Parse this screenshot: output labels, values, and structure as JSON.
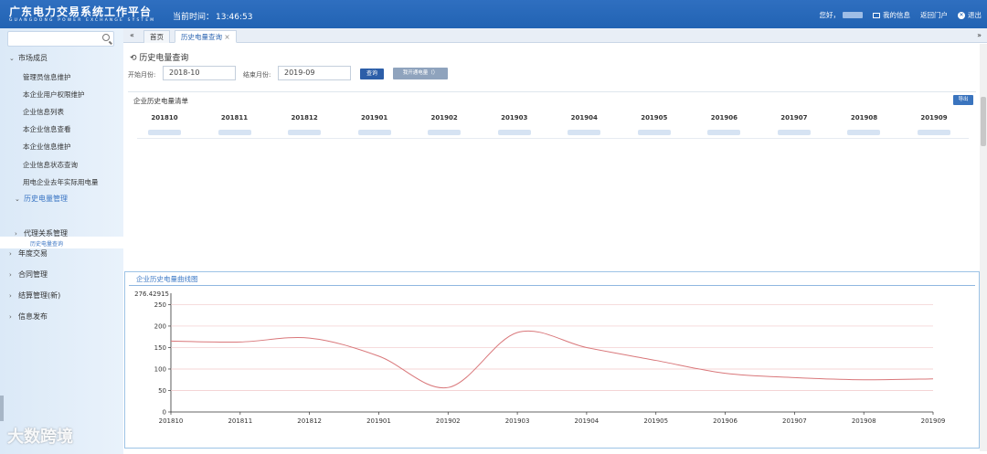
{
  "header": {
    "title": "广东电力交易系统工作平台",
    "subtitle": "GUANGDONG POWER EXCHANGE SYSTEM",
    "clock_label": "当前时间：",
    "clock_value": "13:46:53",
    "greeting": "您好，",
    "my_info": "我的信息",
    "portal": "返回门户",
    "logout": "退出"
  },
  "sidebar": {
    "groups": [
      {
        "label": "市场成员",
        "expanded": true
      },
      {
        "label": "年度交易"
      },
      {
        "label": "合同管理"
      },
      {
        "label": "结算管理(新)"
      },
      {
        "label": "信息发布"
      }
    ],
    "items": [
      "管理员信息维护",
      "本企业用户权限维护",
      "企业信息列表",
      "本企业信息查看",
      "本企业信息维护",
      "企业信息状态查询",
      "用电企业去年实际用电量"
    ],
    "history_group": "历史电量管理",
    "history_item": "历史电量查询",
    "agent_group": "代理关系管理"
  },
  "tabs": {
    "home": "首页",
    "current": "历史电量查询",
    "close": "×"
  },
  "page": {
    "title": "历史电量查询",
    "start_label": "开始月份:",
    "start_value": "2018-10",
    "end_label": "结束月份:",
    "end_value": "2019-09",
    "query_btn": "查询",
    "open_btn": "我开通电量（）",
    "list_title": "企业历史电量清单",
    "export_btn": "导出",
    "chart_title": "企业历史电量曲线图"
  },
  "table_columns": [
    "201810",
    "201811",
    "201812",
    "201901",
    "201902",
    "201903",
    "201904",
    "201905",
    "201906",
    "201907",
    "201908",
    "201909"
  ],
  "chart_data": {
    "type": "line",
    "categories": [
      "201810",
      "201811",
      "201812",
      "201901",
      "201902",
      "201903",
      "201904",
      "201905",
      "201906",
      "201907",
      "201908",
      "201909"
    ],
    "values": [
      165,
      163,
      172,
      130,
      57,
      185,
      150,
      120,
      90,
      80,
      75,
      77
    ],
    "yticks": [
      "0",
      "50",
      "100",
      "150",
      "200",
      "250"
    ],
    "ymax_label": "276.42915",
    "ylim": [
      0,
      276.42915
    ],
    "color": "#d9777a",
    "grid_color": "#f0c7c9"
  },
  "watermark": "大数跨境"
}
